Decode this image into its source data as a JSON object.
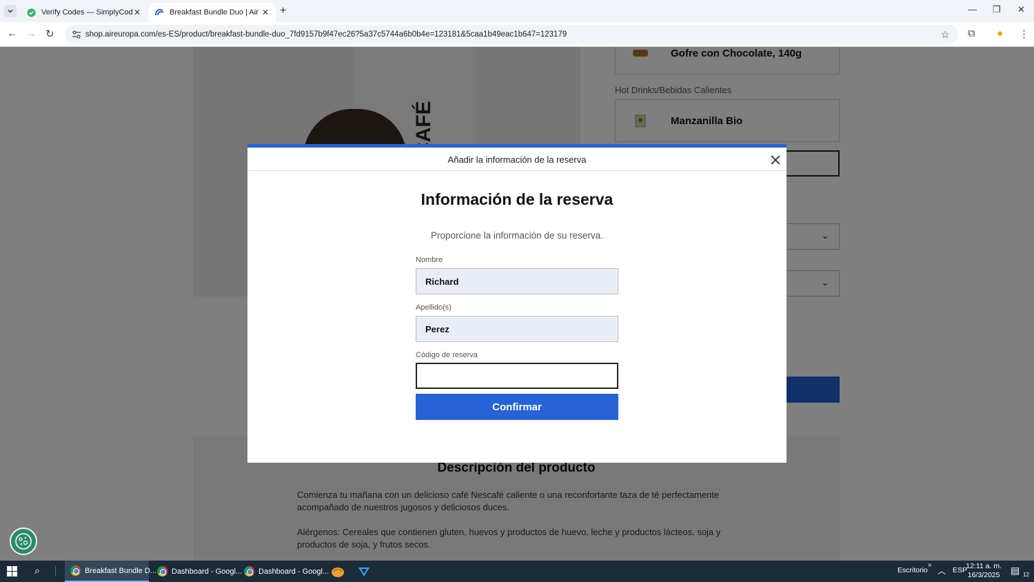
{
  "browser": {
    "tabs": [
      {
        "title": "Verify Codes — SimplyCodes",
        "icon": "simplycodes-icon"
      },
      {
        "title": "Breakfast Bundle Duo | Air Europa",
        "icon": "aireuropa-icon"
      }
    ],
    "url": "shop.aireuropa.com/es-ES/product/breakfast-bundle-duo_7fd9157b9f47ec26?5a37c5744a6b0b4e=123181&5caa1b49eac1b647=123179"
  },
  "page": {
    "product_items": [
      {
        "name": "Gofre con Chocolate, 140g"
      },
      {
        "category": "Hot Drinks/Bebidas Calientes",
        "name": "Manzanilla Bio"
      }
    ],
    "cup_brand": "SCAFÉ",
    "description": {
      "title": "Descripción del producto",
      "paragraph1": "Comienza tu mañana con un delicioso café Nescafé caliente o una reconfortante taza de té perfectamente acompañado de nuestros jugosos y deliciosos duces.",
      "paragraph2": "Alérgenos: Cereales que contienen gluten, huevos y productos de huevo, leche y productos lácteos, soja y productos de soja, y frutos secos."
    }
  },
  "modal": {
    "header_title": "Añadir la información de la reserva",
    "title": "Información de la reserva",
    "subtitle": "Proporcione la información de su reserva.",
    "fields": {
      "first_name": {
        "label": "Nombre",
        "value": "Richard"
      },
      "last_name": {
        "label": "Apellido(s)",
        "value": "Perez"
      },
      "booking_code": {
        "label": "Código de reserva",
        "value": ""
      }
    },
    "confirm_label": "Confirmar",
    "accent_color": "#2563d6"
  },
  "taskbar": {
    "apps": [
      {
        "label": "Breakfast Bundle D..."
      },
      {
        "label": "Dashboard - Googl..."
      },
      {
        "label": "Dashboard - Googl..."
      }
    ],
    "desktop_label": "Escritorio",
    "language": "ESP",
    "time": "12:11 a. m.",
    "date": "16/3/2025",
    "notification_count": "12"
  }
}
